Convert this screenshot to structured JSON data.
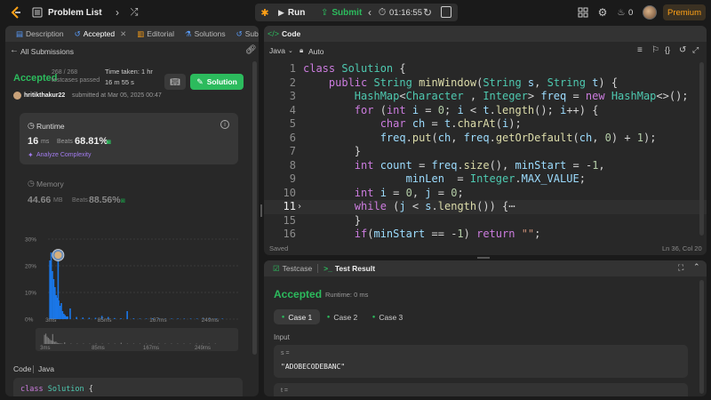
{
  "topbar": {
    "problem_list": "Problem List",
    "run": "Run",
    "submit": "Submit",
    "timer": "01:16:55",
    "streak": "0",
    "premium": "Premium"
  },
  "left_tabs": {
    "description": "Description",
    "accepted": "Accepted",
    "editorial": "Editorial",
    "solutions": "Solutions",
    "submissions": "Submi"
  },
  "submission": {
    "back_label": "All Submissions",
    "status": "Accepted",
    "testcases": "268 / 268",
    "testcases_label": "testcases passed",
    "time_taken_label": "Time taken: 1 hr",
    "time_taken_value": "16 m 55 s",
    "solution_button": "Solution",
    "user": "hritikthakur22",
    "submitted_text": "submitted at Mar 05, 2025 00:47"
  },
  "runtime": {
    "label": "Runtime",
    "value": "16",
    "unit": "ms",
    "beats_label": "Beats",
    "beats": "68.81%",
    "analyze": "Analyze Complexity"
  },
  "memory": {
    "label": "Memory",
    "value": "44.66",
    "unit": "MB",
    "beats_label": "Beats",
    "beats": "88.56%"
  },
  "chart_data": {
    "type": "bar",
    "ytick_labels": [
      "30%",
      "20%",
      "10%",
      "0%"
    ],
    "xtick_labels": [
      "3ms",
      "85ms",
      "167ms",
      "249ms"
    ],
    "x": [
      3,
      5,
      7,
      9,
      11,
      13,
      15,
      16,
      17,
      19,
      21,
      23,
      25,
      27,
      29,
      31,
      35,
      45,
      55,
      65,
      75,
      85,
      95,
      105,
      115,
      125,
      135,
      145,
      155,
      165,
      175,
      185,
      195,
      205,
      215,
      225,
      235,
      245,
      255,
      265,
      275
    ],
    "values": [
      22,
      25,
      18,
      15,
      12,
      9,
      8,
      24,
      7,
      5,
      6,
      3,
      2,
      1.5,
      1,
      1,
      4,
      0.8,
      0.6,
      0.5,
      0.5,
      1.2,
      0.8,
      0.4,
      0.3,
      3,
      0.3,
      0.2,
      0.2,
      0.3,
      0.2,
      0.2,
      0.2,
      0.2,
      0.1,
      0.1,
      0.1,
      0.1,
      0.1,
      0.1,
      0.1
    ],
    "ylim": [
      0,
      30
    ],
    "xlim": [
      0,
      300
    ],
    "highlight_x": 16,
    "mini_xtick_labels": [
      "3ms",
      "85ms",
      "167ms",
      "249ms"
    ]
  },
  "code_footer": {
    "code_label": "Code",
    "lang": "Java",
    "snippet": "class Solution {"
  },
  "editor": {
    "tab": "Code",
    "language": "Java",
    "mode": "Auto",
    "saved": "Saved",
    "position": "Ln 36, Col 20",
    "lines": [
      {
        "n": "1",
        "tokens": [
          [
            "kw",
            "class "
          ],
          [
            "ty",
            "Solution"
          ],
          [
            "pl",
            " {"
          ]
        ]
      },
      {
        "n": "2",
        "tokens": [
          [
            "pl",
            "    "
          ],
          [
            "kw",
            "public "
          ],
          [
            "ty",
            "String "
          ],
          [
            "fn",
            "minWindow"
          ],
          [
            "pl",
            "("
          ],
          [
            "ty",
            "String "
          ],
          [
            "vr",
            "s"
          ],
          [
            "pl",
            ", "
          ],
          [
            "ty",
            "String "
          ],
          [
            "vr",
            "t"
          ],
          [
            "pl",
            ") {"
          ]
        ]
      },
      {
        "n": "3",
        "tokens": [
          [
            "pl",
            "        "
          ],
          [
            "ty",
            "HashMap"
          ],
          [
            "pl",
            "<"
          ],
          [
            "ty",
            "Character "
          ],
          [
            "pl",
            ", "
          ],
          [
            "ty",
            "Integer"
          ],
          [
            "pl",
            "> "
          ],
          [
            "vr",
            "freq "
          ],
          [
            "pl",
            "= "
          ],
          [
            "kw",
            "new "
          ],
          [
            "ty",
            "HashMap"
          ],
          [
            "pl",
            "<>();"
          ]
        ]
      },
      {
        "n": "4",
        "tokens": [
          [
            "pl",
            "        "
          ],
          [
            "kw",
            "for "
          ],
          [
            "pl",
            "("
          ],
          [
            "kw",
            "int "
          ],
          [
            "vr",
            "i "
          ],
          [
            "pl",
            "= "
          ],
          [
            "num",
            "0"
          ],
          [
            "pl",
            "; "
          ],
          [
            "vr",
            "i "
          ],
          [
            "pl",
            "< "
          ],
          [
            "vr",
            "t"
          ],
          [
            "pl",
            "."
          ],
          [
            "fn",
            "length"
          ],
          [
            "pl",
            "(); "
          ],
          [
            "vr",
            "i"
          ],
          [
            "pl",
            "++) {"
          ]
        ]
      },
      {
        "n": "5",
        "tokens": [
          [
            "pl",
            "            "
          ],
          [
            "kw",
            "char "
          ],
          [
            "vr",
            "ch "
          ],
          [
            "pl",
            "= "
          ],
          [
            "vr",
            "t"
          ],
          [
            "pl",
            "."
          ],
          [
            "fn",
            "charAt"
          ],
          [
            "pl",
            "("
          ],
          [
            "vr",
            "i"
          ],
          [
            "pl",
            ");"
          ]
        ]
      },
      {
        "n": "6",
        "tokens": [
          [
            "pl",
            "            "
          ],
          [
            "vr",
            "freq"
          ],
          [
            "pl",
            "."
          ],
          [
            "fn",
            "put"
          ],
          [
            "pl",
            "("
          ],
          [
            "vr",
            "ch"
          ],
          [
            "pl",
            ", "
          ],
          [
            "vr",
            "freq"
          ],
          [
            "pl",
            "."
          ],
          [
            "fn",
            "getOrDefault"
          ],
          [
            "pl",
            "("
          ],
          [
            "vr",
            "ch"
          ],
          [
            "pl",
            ", "
          ],
          [
            "num",
            "0"
          ],
          [
            "pl",
            ") + "
          ],
          [
            "num",
            "1"
          ],
          [
            "pl",
            ");"
          ]
        ]
      },
      {
        "n": "7",
        "tokens": [
          [
            "pl",
            "        }"
          ]
        ]
      },
      {
        "n": "8",
        "tokens": [
          [
            "pl",
            "        "
          ],
          [
            "kw",
            "int "
          ],
          [
            "vr",
            "count "
          ],
          [
            "pl",
            "= "
          ],
          [
            "vr",
            "freq"
          ],
          [
            "pl",
            "."
          ],
          [
            "fn",
            "size"
          ],
          [
            "pl",
            "(), "
          ],
          [
            "vr",
            "minStart "
          ],
          [
            "pl",
            "= -"
          ],
          [
            "num",
            "1"
          ],
          [
            "pl",
            ","
          ]
        ]
      },
      {
        "n": "9",
        "tokens": [
          [
            "pl",
            "                "
          ],
          [
            "vr",
            "minLen  "
          ],
          [
            "pl",
            "= "
          ],
          [
            "ty",
            "Integer"
          ],
          [
            "pl",
            "."
          ],
          [
            "vr",
            "MAX_VALUE"
          ],
          [
            "pl",
            ";"
          ]
        ]
      },
      {
        "n": "10",
        "tokens": [
          [
            "pl",
            "        "
          ],
          [
            "kw",
            "int "
          ],
          [
            "vr",
            "i "
          ],
          [
            "pl",
            "= "
          ],
          [
            "num",
            "0"
          ],
          [
            "pl",
            ", "
          ],
          [
            "vr",
            "j "
          ],
          [
            "pl",
            "= "
          ],
          [
            "num",
            "0"
          ],
          [
            "pl",
            ";"
          ]
        ]
      },
      {
        "n": "11",
        "tokens": [
          [
            "pl",
            "        "
          ],
          [
            "kw",
            "while "
          ],
          [
            "pl",
            "("
          ],
          [
            "vr",
            "j "
          ],
          [
            "pl",
            "< "
          ],
          [
            "vr",
            "s"
          ],
          [
            "pl",
            "."
          ],
          [
            "fn",
            "length"
          ],
          [
            "pl",
            "()) {"
          ],
          [
            "pl",
            "⋯"
          ]
        ]
      },
      {
        "n": "15",
        "tokens": [
          [
            "pl",
            "        }"
          ]
        ]
      },
      {
        "n": "16",
        "tokens": [
          [
            "pl",
            "        "
          ],
          [
            "kw",
            "if"
          ],
          [
            "pl",
            "("
          ],
          [
            "vr",
            "minStart "
          ],
          [
            "pl",
            "== -"
          ],
          [
            "num",
            "1"
          ],
          [
            "pl",
            ") "
          ],
          [
            "kw",
            "return "
          ],
          [
            "str",
            "\"\""
          ],
          [
            "pl",
            ";"
          ]
        ]
      }
    ]
  },
  "testpanel": {
    "tab1": "Testcase",
    "tab2": "Test Result",
    "status": "Accepted",
    "runtime": "Runtime: 0 ms",
    "cases": [
      "Case 1",
      "Case 2",
      "Case 3"
    ],
    "input_label": "Input",
    "s_label": "s =",
    "s_value": "\"ADOBECODEBANC\"",
    "t_label": "t ="
  },
  "colors": {
    "accent_green": "#2cbb5d",
    "accent_orange": "#ffa116",
    "bar_blue": "#1a77e8",
    "panel": "#282828",
    "bg": "#1a1a1a"
  }
}
